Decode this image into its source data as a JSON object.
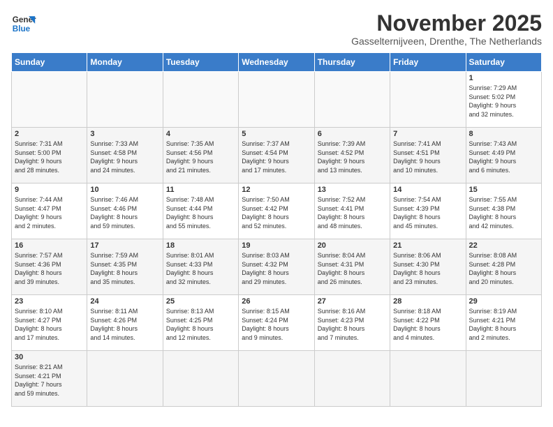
{
  "logo": {
    "line1": "General",
    "line2": "Blue"
  },
  "title": "November 2025",
  "subtitle": "Gasselternijveen, Drenthe, The Netherlands",
  "weekdays": [
    "Sunday",
    "Monday",
    "Tuesday",
    "Wednesday",
    "Thursday",
    "Friday",
    "Saturday"
  ],
  "weeks": [
    [
      {
        "day": "",
        "info": ""
      },
      {
        "day": "",
        "info": ""
      },
      {
        "day": "",
        "info": ""
      },
      {
        "day": "",
        "info": ""
      },
      {
        "day": "",
        "info": ""
      },
      {
        "day": "",
        "info": ""
      },
      {
        "day": "1",
        "info": "Sunrise: 7:29 AM\nSunset: 5:02 PM\nDaylight: 9 hours\nand 32 minutes."
      }
    ],
    [
      {
        "day": "2",
        "info": "Sunrise: 7:31 AM\nSunset: 5:00 PM\nDaylight: 9 hours\nand 28 minutes."
      },
      {
        "day": "3",
        "info": "Sunrise: 7:33 AM\nSunset: 4:58 PM\nDaylight: 9 hours\nand 24 minutes."
      },
      {
        "day": "4",
        "info": "Sunrise: 7:35 AM\nSunset: 4:56 PM\nDaylight: 9 hours\nand 21 minutes."
      },
      {
        "day": "5",
        "info": "Sunrise: 7:37 AM\nSunset: 4:54 PM\nDaylight: 9 hours\nand 17 minutes."
      },
      {
        "day": "6",
        "info": "Sunrise: 7:39 AM\nSunset: 4:52 PM\nDaylight: 9 hours\nand 13 minutes."
      },
      {
        "day": "7",
        "info": "Sunrise: 7:41 AM\nSunset: 4:51 PM\nDaylight: 9 hours\nand 10 minutes."
      },
      {
        "day": "8",
        "info": "Sunrise: 7:43 AM\nSunset: 4:49 PM\nDaylight: 9 hours\nand 6 minutes."
      }
    ],
    [
      {
        "day": "9",
        "info": "Sunrise: 7:44 AM\nSunset: 4:47 PM\nDaylight: 9 hours\nand 2 minutes."
      },
      {
        "day": "10",
        "info": "Sunrise: 7:46 AM\nSunset: 4:46 PM\nDaylight: 8 hours\nand 59 minutes."
      },
      {
        "day": "11",
        "info": "Sunrise: 7:48 AM\nSunset: 4:44 PM\nDaylight: 8 hours\nand 55 minutes."
      },
      {
        "day": "12",
        "info": "Sunrise: 7:50 AM\nSunset: 4:42 PM\nDaylight: 8 hours\nand 52 minutes."
      },
      {
        "day": "13",
        "info": "Sunrise: 7:52 AM\nSunset: 4:41 PM\nDaylight: 8 hours\nand 48 minutes."
      },
      {
        "day": "14",
        "info": "Sunrise: 7:54 AM\nSunset: 4:39 PM\nDaylight: 8 hours\nand 45 minutes."
      },
      {
        "day": "15",
        "info": "Sunrise: 7:55 AM\nSunset: 4:38 PM\nDaylight: 8 hours\nand 42 minutes."
      }
    ],
    [
      {
        "day": "16",
        "info": "Sunrise: 7:57 AM\nSunset: 4:36 PM\nDaylight: 8 hours\nand 39 minutes."
      },
      {
        "day": "17",
        "info": "Sunrise: 7:59 AM\nSunset: 4:35 PM\nDaylight: 8 hours\nand 35 minutes."
      },
      {
        "day": "18",
        "info": "Sunrise: 8:01 AM\nSunset: 4:33 PM\nDaylight: 8 hours\nand 32 minutes."
      },
      {
        "day": "19",
        "info": "Sunrise: 8:03 AM\nSunset: 4:32 PM\nDaylight: 8 hours\nand 29 minutes."
      },
      {
        "day": "20",
        "info": "Sunrise: 8:04 AM\nSunset: 4:31 PM\nDaylight: 8 hours\nand 26 minutes."
      },
      {
        "day": "21",
        "info": "Sunrise: 8:06 AM\nSunset: 4:30 PM\nDaylight: 8 hours\nand 23 minutes."
      },
      {
        "day": "22",
        "info": "Sunrise: 8:08 AM\nSunset: 4:28 PM\nDaylight: 8 hours\nand 20 minutes."
      }
    ],
    [
      {
        "day": "23",
        "info": "Sunrise: 8:10 AM\nSunset: 4:27 PM\nDaylight: 8 hours\nand 17 minutes."
      },
      {
        "day": "24",
        "info": "Sunrise: 8:11 AM\nSunset: 4:26 PM\nDaylight: 8 hours\nand 14 minutes."
      },
      {
        "day": "25",
        "info": "Sunrise: 8:13 AM\nSunset: 4:25 PM\nDaylight: 8 hours\nand 12 minutes."
      },
      {
        "day": "26",
        "info": "Sunrise: 8:15 AM\nSunset: 4:24 PM\nDaylight: 8 hours\nand 9 minutes."
      },
      {
        "day": "27",
        "info": "Sunrise: 8:16 AM\nSunset: 4:23 PM\nDaylight: 8 hours\nand 7 minutes."
      },
      {
        "day": "28",
        "info": "Sunrise: 8:18 AM\nSunset: 4:22 PM\nDaylight: 8 hours\nand 4 minutes."
      },
      {
        "day": "29",
        "info": "Sunrise: 8:19 AM\nSunset: 4:21 PM\nDaylight: 8 hours\nand 2 minutes."
      }
    ],
    [
      {
        "day": "30",
        "info": "Sunrise: 8:21 AM\nSunset: 4:21 PM\nDaylight: 7 hours\nand 59 minutes."
      },
      {
        "day": "",
        "info": ""
      },
      {
        "day": "",
        "info": ""
      },
      {
        "day": "",
        "info": ""
      },
      {
        "day": "",
        "info": ""
      },
      {
        "day": "",
        "info": ""
      },
      {
        "day": "",
        "info": ""
      }
    ]
  ]
}
